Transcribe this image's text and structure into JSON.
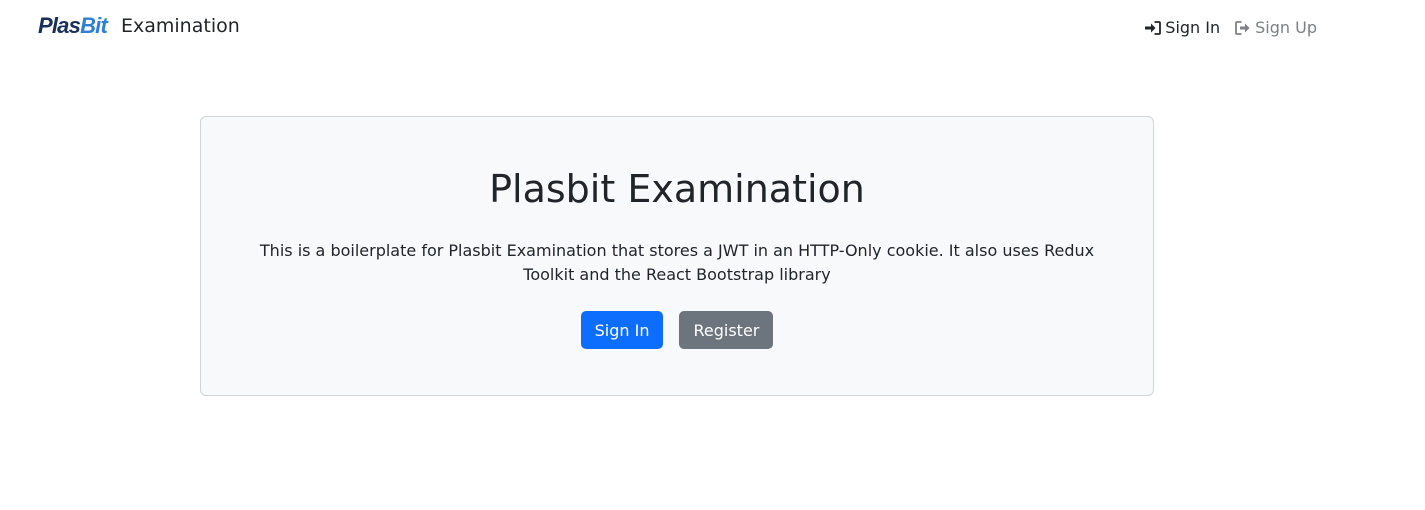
{
  "navbar": {
    "logo_part_a": "Plas",
    "logo_part_b": "Bit",
    "brand_text": "Examination",
    "links": [
      {
        "label": "Sign In",
        "icon": "sign-in-icon"
      },
      {
        "label": "Sign Up",
        "icon": "sign-up-icon"
      }
    ]
  },
  "hero": {
    "title": "Plasbit Examination",
    "description": "This is a boilerplate for Plasbit Examination that stores a JWT in an HTTP-Only cookie. It also uses Redux Toolkit and the React Bootstrap library",
    "primary_button": "Sign In",
    "secondary_button": "Register"
  },
  "colors": {
    "primary": "#0d6efd",
    "secondary": "#6c757d",
    "logo_dark": "#1a2f5a",
    "logo_accent": "#2f7fd2",
    "card_bg": "#f8f9fa"
  }
}
